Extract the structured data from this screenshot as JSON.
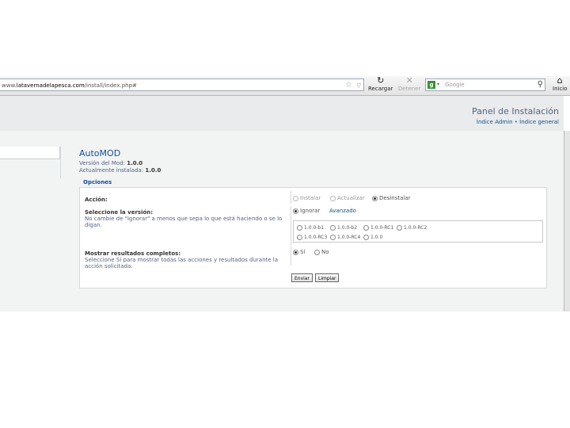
{
  "browser": {
    "url_prefix": "www.",
    "url_domain": "latavernadelapesca.com",
    "url_path": "/install/index.php#",
    "reload_label": "Recargar",
    "stop_label": "Detener",
    "search_placeholder": "Google",
    "home_label": "Inicio"
  },
  "header": {
    "title": "Panel de Instalación",
    "link_admin": "Índice Admin",
    "separator": "•",
    "link_general": "Índice general"
  },
  "mod": {
    "title": "AutoMOD",
    "version_label": "Versión del Mod:",
    "version_value": "1.0.0",
    "installed_label": "Actualmente instalada:",
    "installed_value": "1.0.0"
  },
  "options": {
    "legend": "Opciones",
    "action": {
      "label": "Acción:",
      "choices": [
        "Instalar",
        "Actualizar",
        "Desinstalar"
      ],
      "selected": "Desinstalar"
    },
    "version": {
      "label": "Seleccione la versión:",
      "desc": "No cambie de \"Ignorar\" a menos que sepa lo que está haciendo o se lo digan.",
      "ignore_label": "Ignorar",
      "advanced_link": "Avanzado",
      "versions": [
        "1.0.0-b1",
        "1.0.0-b2",
        "1.0.0-RC1",
        "1.0.0-RC2",
        "1.0.0-RC3",
        "1.0.0-RC4",
        "1.0.0"
      ]
    },
    "verbose": {
      "label": "Mostrar resultados completos:",
      "desc": "Seleccione Sí para mostrar todas las acciones y resultados durante la acción solicitada.",
      "yes": "Sí",
      "no": "No",
      "selected": "Sí"
    },
    "submit_label": "Enviar",
    "reset_label": "Limpiar"
  }
}
